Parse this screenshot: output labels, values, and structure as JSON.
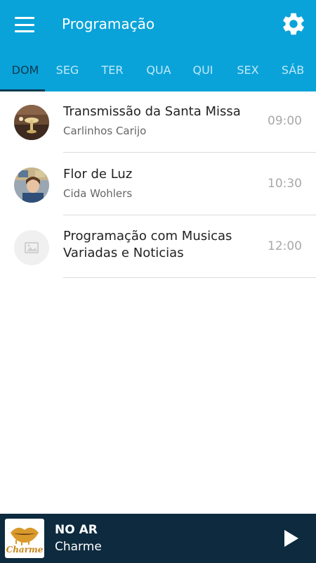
{
  "header": {
    "title": "Programação",
    "menu_icon": "hamburger-menu-icon",
    "settings_icon": "gear-icon"
  },
  "tabs": [
    {
      "label": "DOM",
      "active": true
    },
    {
      "label": "SEG"
    },
    {
      "label": "TER"
    },
    {
      "label": "QUA"
    },
    {
      "label": "QUI"
    },
    {
      "label": "SEX"
    },
    {
      "label": "SÁB"
    }
  ],
  "schedule": [
    {
      "title": "Transmissão da Santa Missa",
      "host": "Carlinhos Carijo",
      "time": "09:00"
    },
    {
      "title": "Flor de Luz",
      "host": "Cida Wohlers",
      "time": "10:30"
    },
    {
      "title_line1": "Programação com Musicas",
      "title_line2": "Variadas e Noticias",
      "host": "",
      "time": "12:00"
    }
  ],
  "player": {
    "status": "NO AR",
    "station": "Charme",
    "logo_text": "Charme",
    "play_icon": "play-icon"
  },
  "colors": {
    "appbar": "#0aa3d9",
    "tab_active": "#0d3a4f",
    "player_bg": "#0d2a3e"
  }
}
